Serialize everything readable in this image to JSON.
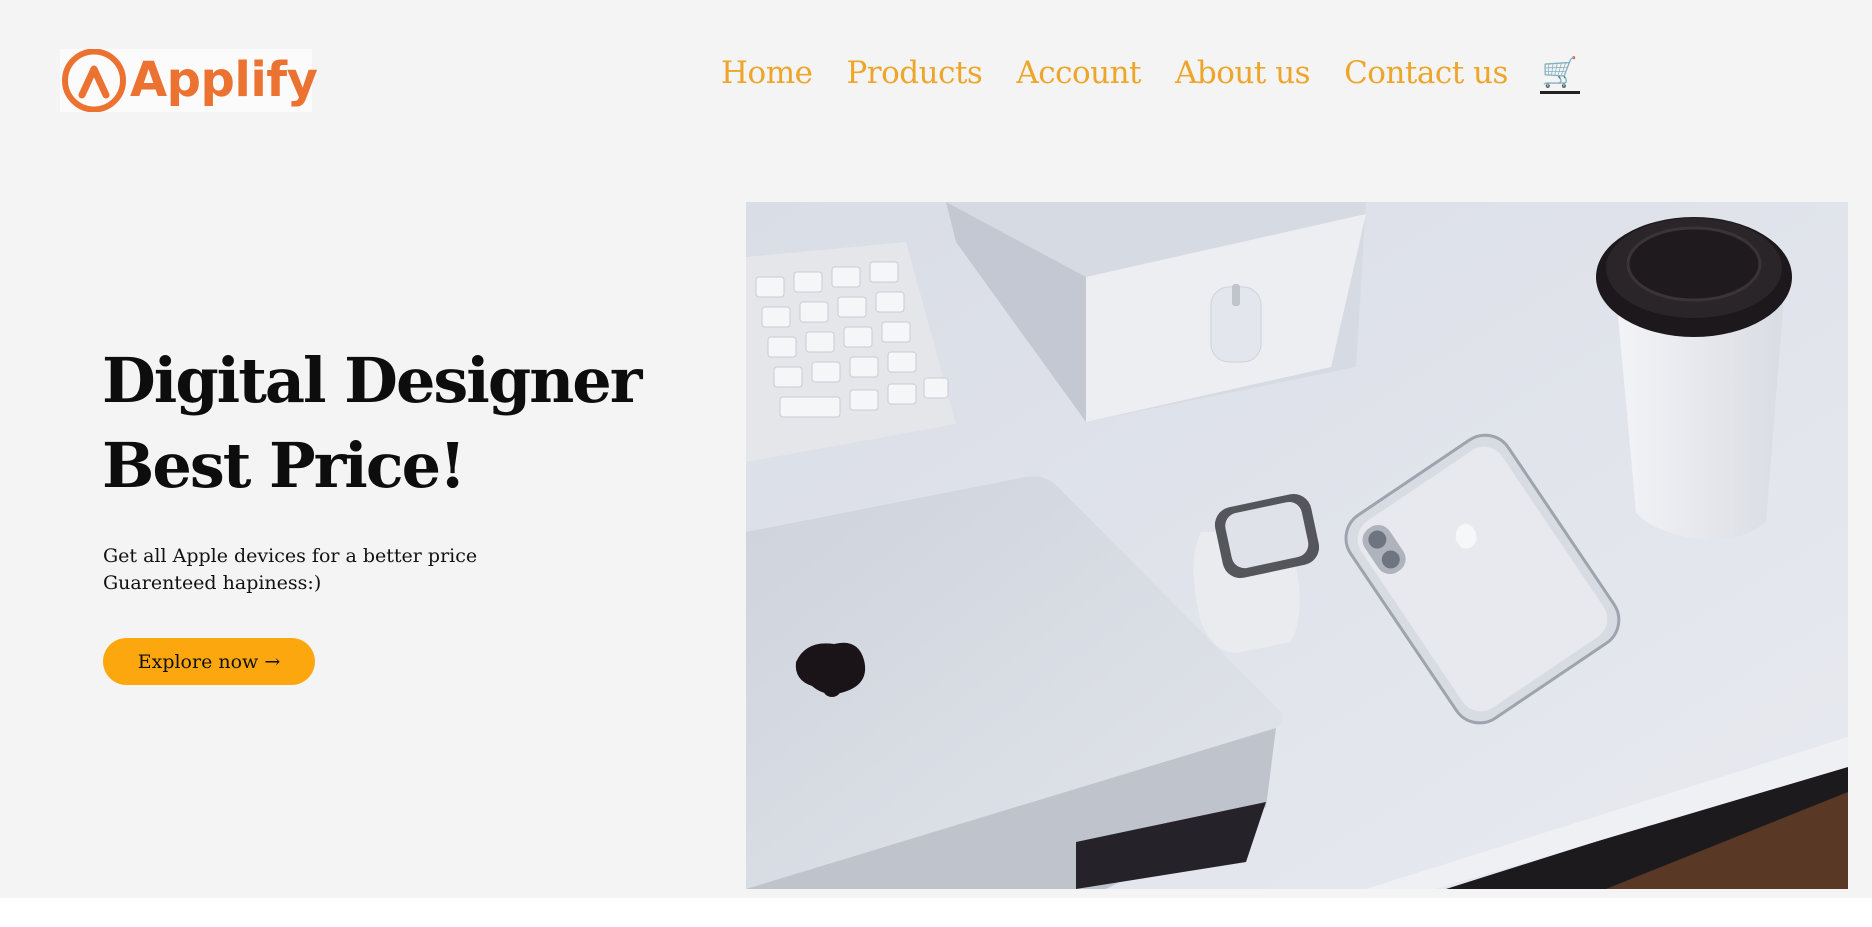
{
  "brand": {
    "name": "Applify",
    "color": "#ec7232"
  },
  "nav": {
    "items": [
      "Home",
      "Products",
      "Account",
      "About us",
      "Contact us"
    ],
    "cart_icon": "cart-icon",
    "color": "#eda52a"
  },
  "hero": {
    "headline_line1": "Digital Designer",
    "headline_line2": "Best Price!",
    "sub_line1": "Get all Apple devices for a better price",
    "sub_line2": "Guarenteed hapiness:)",
    "cta_label": "Explore now →",
    "cta_color": "#fda70f",
    "image_description": "product-photo"
  }
}
